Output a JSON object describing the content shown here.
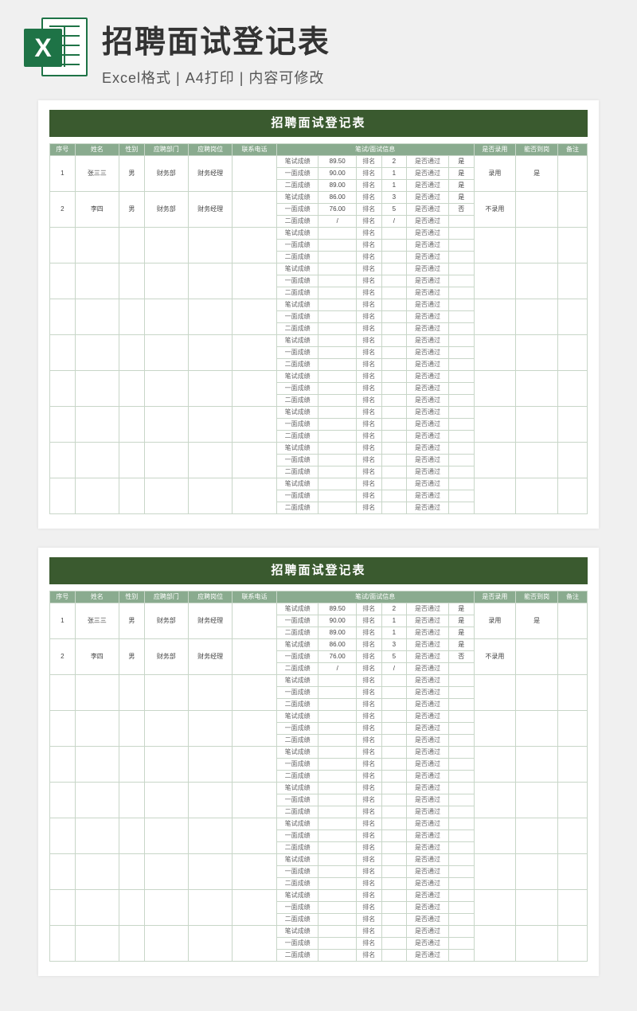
{
  "header": {
    "main_title": "招聘面试登记表",
    "subtitle": "Excel格式 | A4打印 | 内容可修改",
    "icon_letter": "X"
  },
  "sheet": {
    "title": "招聘面试登记表",
    "cols": {
      "seq": "序号",
      "name": "姓名",
      "gender": "性别",
      "dept": "应聘部门",
      "post": "应聘岗位",
      "phone": "联系电话",
      "exam": "笔试/面试信息",
      "hire": "是否录用",
      "report": "能否到岗",
      "remark": "备注"
    },
    "labels": {
      "written_score": "笔试成绩",
      "r1_score": "一面成绩",
      "r2_score": "二面成绩",
      "rank": "排名",
      "pass": "是否通过"
    },
    "rows": [
      {
        "seq": "1",
        "name": "张三三",
        "gender": "男",
        "dept": "财务部",
        "post": "财务经理",
        "written": {
          "score": "89.50",
          "rank": "2",
          "pass": "是"
        },
        "r1": {
          "score": "90.00",
          "rank": "1",
          "pass": "是"
        },
        "r2": {
          "score": "89.00",
          "rank": "1",
          "pass": "是"
        },
        "hire": "录用",
        "report": "是"
      },
      {
        "seq": "2",
        "name": "李四",
        "gender": "男",
        "dept": "财务部",
        "post": "财务经理",
        "written": {
          "score": "86.00",
          "rank": "3",
          "pass": "是"
        },
        "r1": {
          "score": "76.00",
          "rank": "5",
          "pass": "否"
        },
        "r2": {
          "score": "/",
          "rank": "/",
          "pass": ""
        },
        "hire": "不录用",
        "report": ""
      },
      {
        "seq": "",
        "name": "",
        "gender": "",
        "dept": "",
        "post": "",
        "written": {
          "score": "",
          "rank": "",
          "pass": ""
        },
        "r1": {
          "score": "",
          "rank": "",
          "pass": ""
        },
        "r2": {
          "score": "",
          "rank": "",
          "pass": ""
        },
        "hire": "",
        "report": ""
      },
      {
        "seq": "",
        "name": "",
        "gender": "",
        "dept": "",
        "post": "",
        "written": {
          "score": "",
          "rank": "",
          "pass": ""
        },
        "r1": {
          "score": "",
          "rank": "",
          "pass": ""
        },
        "r2": {
          "score": "",
          "rank": "",
          "pass": ""
        },
        "hire": "",
        "report": ""
      },
      {
        "seq": "",
        "name": "",
        "gender": "",
        "dept": "",
        "post": "",
        "written": {
          "score": "",
          "rank": "",
          "pass": ""
        },
        "r1": {
          "score": "",
          "rank": "",
          "pass": ""
        },
        "r2": {
          "score": "",
          "rank": "",
          "pass": ""
        },
        "hire": "",
        "report": ""
      },
      {
        "seq": "",
        "name": "",
        "gender": "",
        "dept": "",
        "post": "",
        "written": {
          "score": "",
          "rank": "",
          "pass": ""
        },
        "r1": {
          "score": "",
          "rank": "",
          "pass": ""
        },
        "r2": {
          "score": "",
          "rank": "",
          "pass": ""
        },
        "hire": "",
        "report": ""
      },
      {
        "seq": "",
        "name": "",
        "gender": "",
        "dept": "",
        "post": "",
        "written": {
          "score": "",
          "rank": "",
          "pass": ""
        },
        "r1": {
          "score": "",
          "rank": "",
          "pass": ""
        },
        "r2": {
          "score": "",
          "rank": "",
          "pass": ""
        },
        "hire": "",
        "report": ""
      },
      {
        "seq": "",
        "name": "",
        "gender": "",
        "dept": "",
        "post": "",
        "written": {
          "score": "",
          "rank": "",
          "pass": ""
        },
        "r1": {
          "score": "",
          "rank": "",
          "pass": ""
        },
        "r2": {
          "score": "",
          "rank": "",
          "pass": ""
        },
        "hire": "",
        "report": ""
      },
      {
        "seq": "",
        "name": "",
        "gender": "",
        "dept": "",
        "post": "",
        "written": {
          "score": "",
          "rank": "",
          "pass": ""
        },
        "r1": {
          "score": "",
          "rank": "",
          "pass": ""
        },
        "r2": {
          "score": "",
          "rank": "",
          "pass": ""
        },
        "hire": "",
        "report": ""
      },
      {
        "seq": "",
        "name": "",
        "gender": "",
        "dept": "",
        "post": "",
        "written": {
          "score": "",
          "rank": "",
          "pass": ""
        },
        "r1": {
          "score": "",
          "rank": "",
          "pass": ""
        },
        "r2": {
          "score": "",
          "rank": "",
          "pass": ""
        },
        "hire": "",
        "report": ""
      }
    ]
  }
}
